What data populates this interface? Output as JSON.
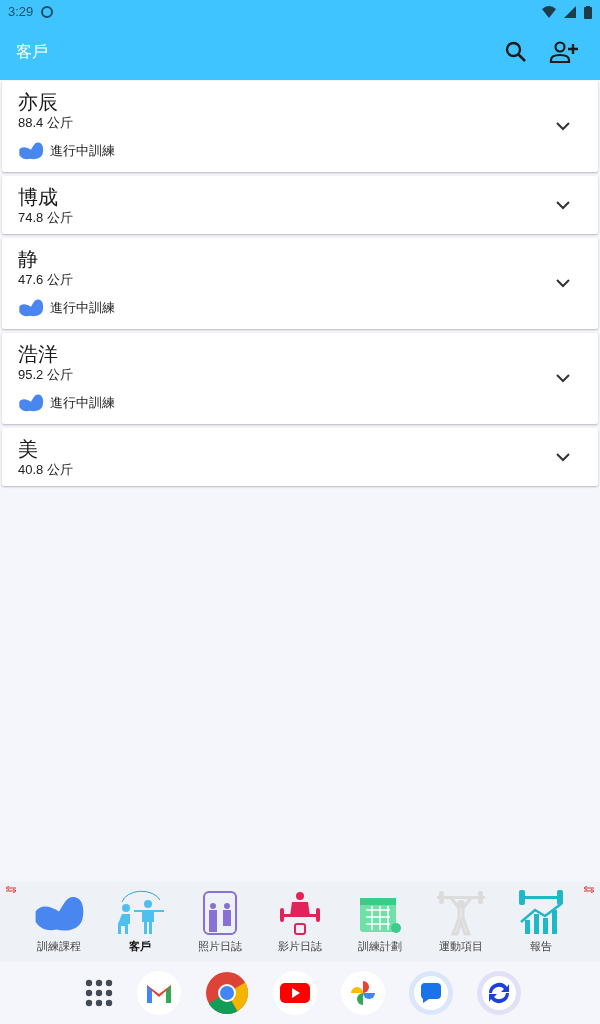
{
  "status_bar": {
    "time": "3:29"
  },
  "app_bar": {
    "title": "客戶"
  },
  "clients": [
    {
      "name": "亦辰",
      "weight": "88.4 公斤",
      "training": true,
      "badge": "進行中訓練",
      "expanded": false
    },
    {
      "name": "博成",
      "weight": "74.8 公斤",
      "training": false,
      "expanded": false
    },
    {
      "name": "静",
      "weight": "47.6 公斤",
      "training": true,
      "badge": "進行中訓練",
      "expanded": false
    },
    {
      "name": "浩洋",
      "weight": "95.2 公斤",
      "training": true,
      "badge": "進行中訓練",
      "expanded": false
    },
    {
      "name": "美",
      "weight": "40.8 公斤",
      "training": false,
      "expanded": false
    }
  ],
  "bottom_nav": [
    {
      "label": "訓練課程",
      "kind": "arm",
      "selected": false
    },
    {
      "label": "客戶",
      "kind": "people",
      "selected": true
    },
    {
      "label": "照片日誌",
      "kind": "photo",
      "selected": false
    },
    {
      "label": "影片日誌",
      "kind": "video",
      "selected": false
    },
    {
      "label": "訓練計劃",
      "kind": "calendar",
      "selected": false
    },
    {
      "label": "運動項目",
      "kind": "barbell",
      "selected": false
    },
    {
      "label": "報告",
      "kind": "report",
      "selected": false
    }
  ],
  "dock": [
    {
      "kind": "apps"
    },
    {
      "kind": "mail"
    },
    {
      "kind": "browser"
    },
    {
      "kind": "video"
    },
    {
      "kind": "photos"
    },
    {
      "kind": "messages"
    },
    {
      "kind": "sync"
    }
  ]
}
